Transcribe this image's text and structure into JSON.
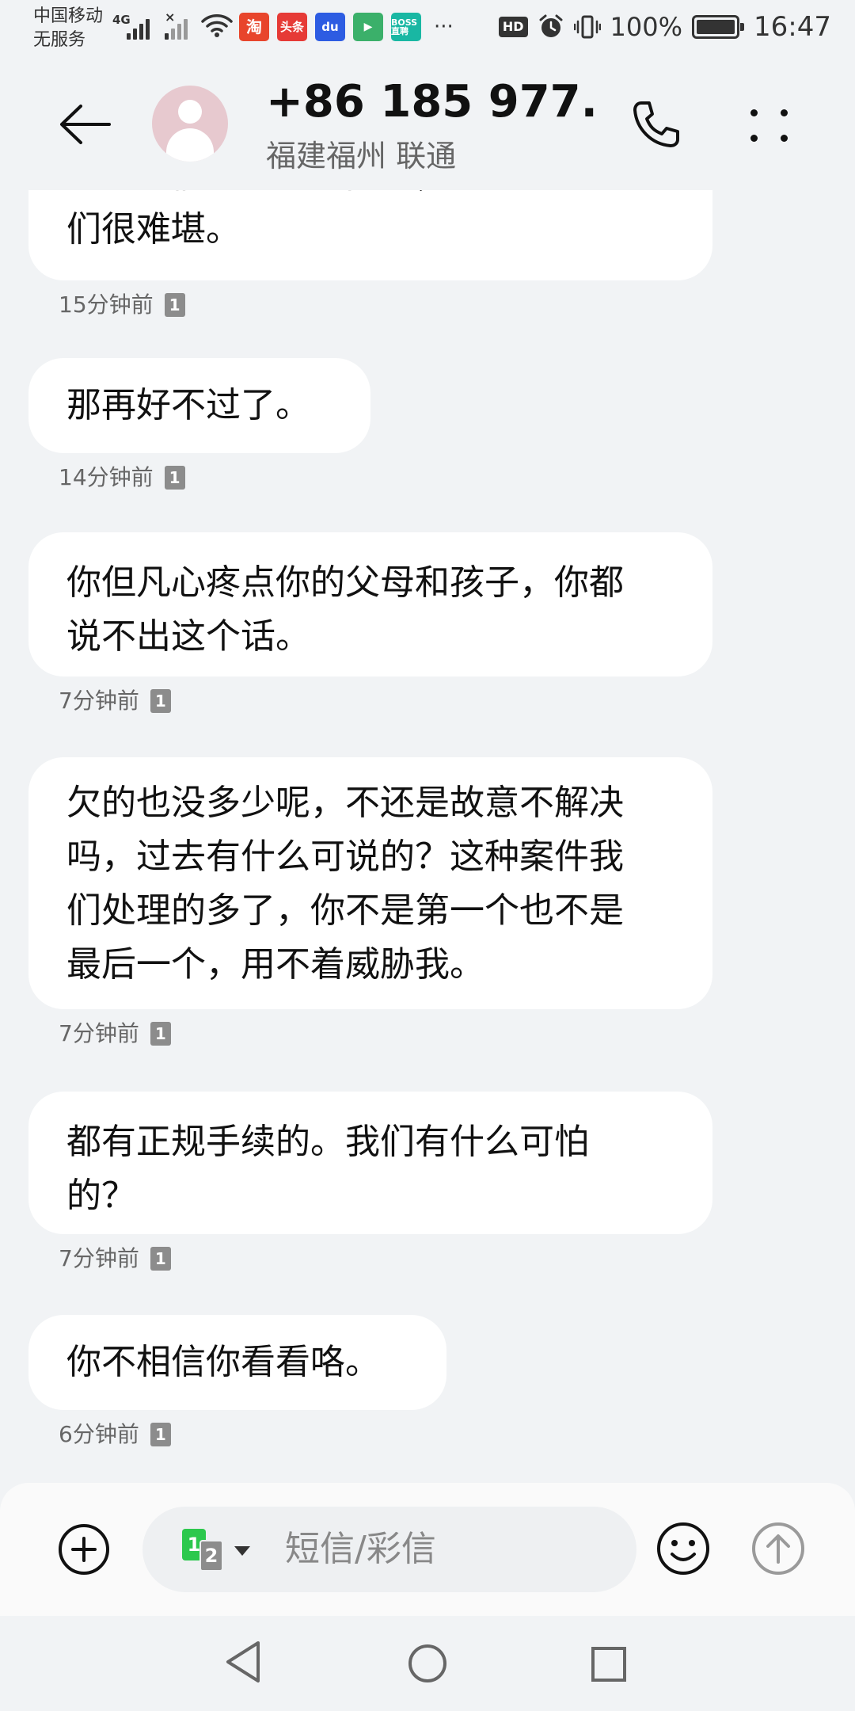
{
  "status_bar": {
    "carrier_line1": "中国移动",
    "carrier_line2": "无服务",
    "network_type": "4G",
    "signal_icon": "signal-bars-icon",
    "wifi_icon": "wifi-icon",
    "notification_apps": [
      {
        "name": "taobao-icon",
        "label": "淘"
      },
      {
        "name": "toutiao-icon",
        "label": "头条"
      },
      {
        "name": "baidu-icon",
        "label": "du"
      },
      {
        "name": "video-app-icon",
        "label": "▶"
      },
      {
        "name": "boss-zhipin-icon",
        "label": "BOSS直聘"
      }
    ],
    "more_notifications": "···",
    "hd_label": "HD",
    "battery_percent": "100%",
    "battery_level": 1.0,
    "time": "16:47"
  },
  "header": {
    "contact_number": "+86 185 977...",
    "contact_location": "福建福州 联通",
    "icons": [
      "back-arrow-icon",
      "avatar-placeholder-icon",
      "phone-icon",
      "more-dots-icon"
    ]
  },
  "messages": [
    {
      "text_lines": [
        "吗？我们总求也上门吗，也不怎让你",
        "们很难堪。"
      ],
      "time": "15分钟前",
      "sim": "1"
    },
    {
      "text_lines": [
        "那再好不过了。"
      ],
      "time": "14分钟前",
      "sim": "1"
    },
    {
      "text_lines": [
        "你但凡心疼点你的父母和孩子，你都",
        "说不出这个话。"
      ],
      "time": "7分钟前",
      "sim": "1"
    },
    {
      "text_lines": [
        "欠的也没多少呢，不还是故意不解决",
        "吗，过去有什么可说的？这种案件我",
        "们处理的多了，你不是第一个也不是",
        "最后一个，用不着威胁我。"
      ],
      "time": "7分钟前",
      "sim": "1"
    },
    {
      "text_lines": [
        "都有正规手续的。我们有什么可怕",
        "的？"
      ],
      "time": "7分钟前",
      "sim": "1"
    },
    {
      "text_lines": [
        "你不相信你看看咯。"
      ],
      "time": "6分钟前",
      "sim": "1"
    }
  ],
  "compose": {
    "placeholder": "短信/彩信",
    "sim1_label": "1",
    "sim2_label": "2",
    "icons": [
      "add-icon",
      "sim-switch-icon",
      "emoji-icon",
      "send-icon"
    ]
  },
  "colors": {
    "background": "#f1f3f5",
    "bubble": "#ffffff",
    "sim1_green": "#2cc84d",
    "sim_badge_gray": "#8c8c8c",
    "avatar_pink": "#e7c9cf"
  }
}
